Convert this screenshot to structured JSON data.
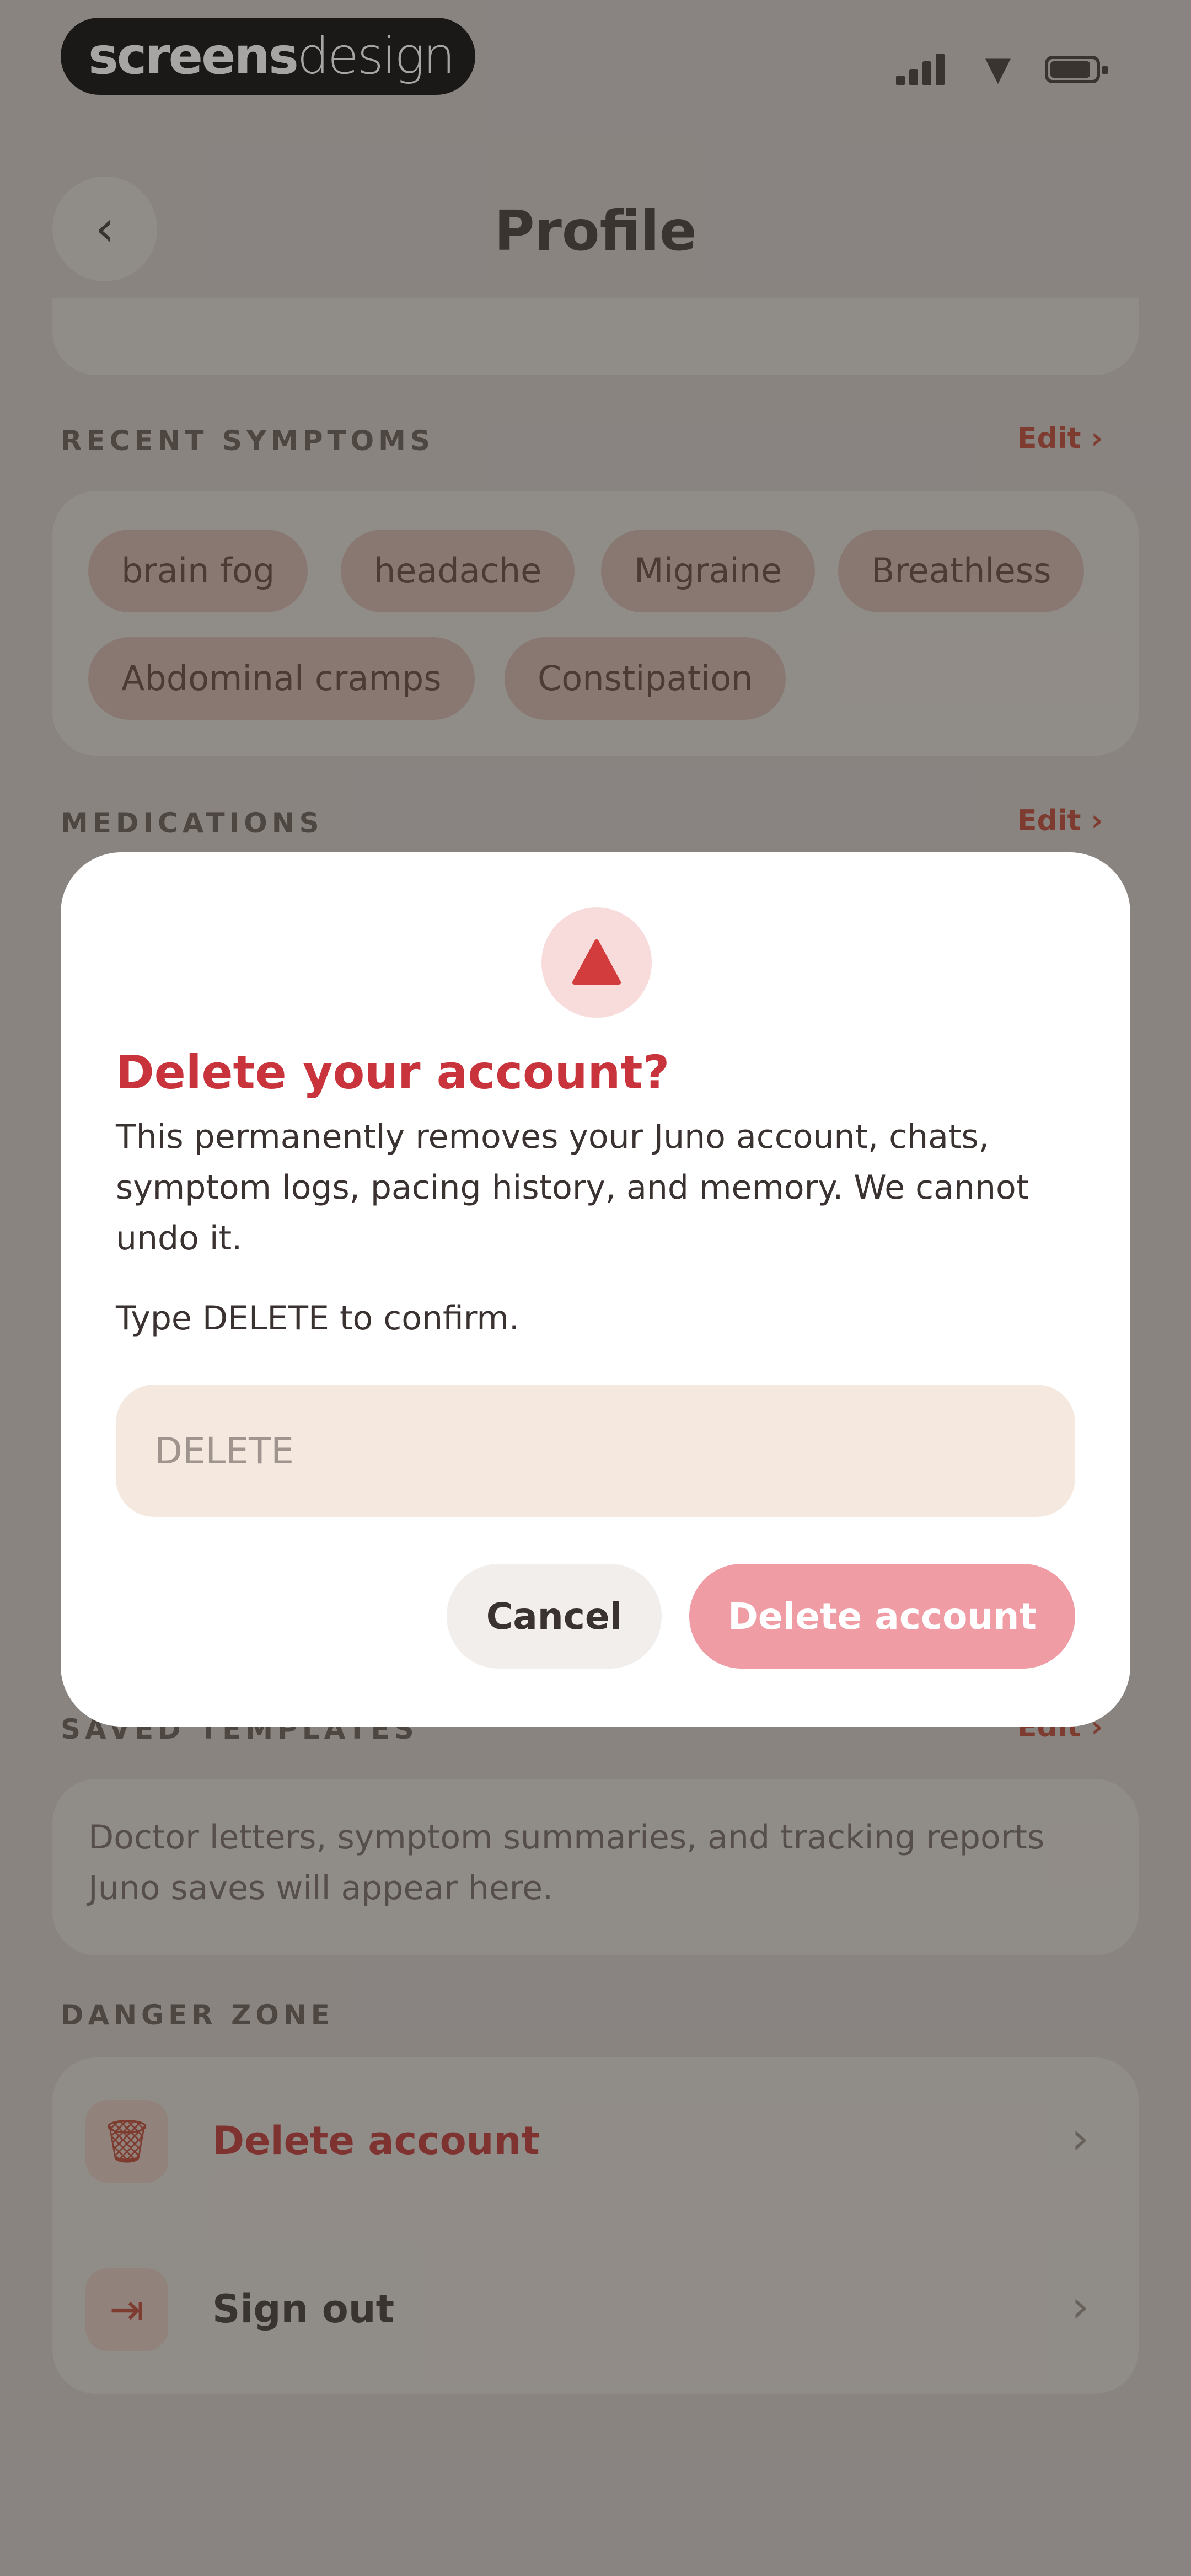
{
  "status_bar": {
    "brand_bold": "screens",
    "brand_light": "design",
    "wifi_glyph": "▼"
  },
  "header": {
    "back_glyph": "‹",
    "title": "Profile"
  },
  "recent_symptoms": {
    "label": "RECENT SYMPTOMS",
    "edit": "Edit ›",
    "chips": [
      "brain fog",
      "headache",
      "Migraine",
      "Breathless",
      "Abdominal cramps",
      "Constipation"
    ]
  },
  "medications": {
    "label": "MEDICATIONS",
    "edit": "Edit ›"
  },
  "saved_templates": {
    "label": "SAVED TEMPLATES",
    "edit": "Edit ›",
    "empty_text": "Doctor letters, symptom summaries, and tracking reports Juno saves will appear here."
  },
  "danger_zone": {
    "label": "DANGER ZONE",
    "items": [
      {
        "label": "Delete account",
        "icon": "trash-icon",
        "glyph": "🗑"
      },
      {
        "label": "Sign out",
        "icon": "sign-out-icon",
        "glyph": "⇥"
      }
    ],
    "chevron": "›"
  },
  "modal": {
    "title": "Delete your account?",
    "body": "This permanently removes your Juno account, chats, symptom logs, pacing history, and memory. We cannot undo it.",
    "confirm_prompt": "Type DELETE to confirm.",
    "input_placeholder": "DELETE",
    "input_value": "",
    "cancel_label": "Cancel",
    "delete_label": "Delete account"
  },
  "colors": {
    "danger": "#c8333c",
    "danger_soft": "#ef9ca4",
    "accent": "#b5412e",
    "input_bg": "#f5e9df"
  }
}
